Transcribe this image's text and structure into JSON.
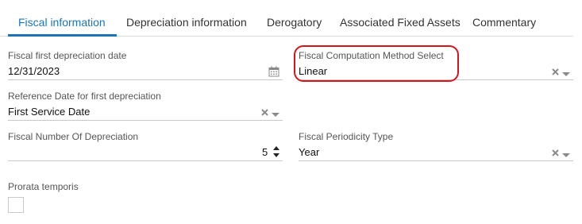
{
  "tabs": [
    {
      "label": "Fiscal information",
      "active": true
    },
    {
      "label": "Depreciation information",
      "active": false
    },
    {
      "label": "Derogatory",
      "active": false
    },
    {
      "label": "Associated Fixed Assets",
      "active": false
    },
    {
      "label": "Commentary",
      "active": false
    }
  ],
  "fields": {
    "fiscal_first_depreciation_date": {
      "label": "Fiscal first depreciation date",
      "value": "12/31/2023",
      "icon": "calendar-icon"
    },
    "fiscal_computation_method": {
      "label": "Fiscal Computation Method Select",
      "value": "Linear",
      "icons": [
        "clear-icon",
        "chevron-down-icon"
      ]
    },
    "reference_date": {
      "label": "Reference Date for first depreciation",
      "value": "First Service Date",
      "icons": [
        "clear-icon",
        "chevron-down-icon"
      ]
    },
    "fiscal_number_of_depreciation": {
      "label": "Fiscal Number Of Depreciation",
      "value": "5",
      "icon": "stepper-icon"
    },
    "fiscal_periodicity_type": {
      "label": "Fiscal Periodicity Type",
      "value": "Year",
      "icons": [
        "clear-icon",
        "chevron-down-icon"
      ]
    },
    "prorata_temporis": {
      "label": "Prorata temporis",
      "checked": false
    }
  },
  "colors": {
    "accent": "#1d74b8",
    "highlight": "#d7141a"
  }
}
